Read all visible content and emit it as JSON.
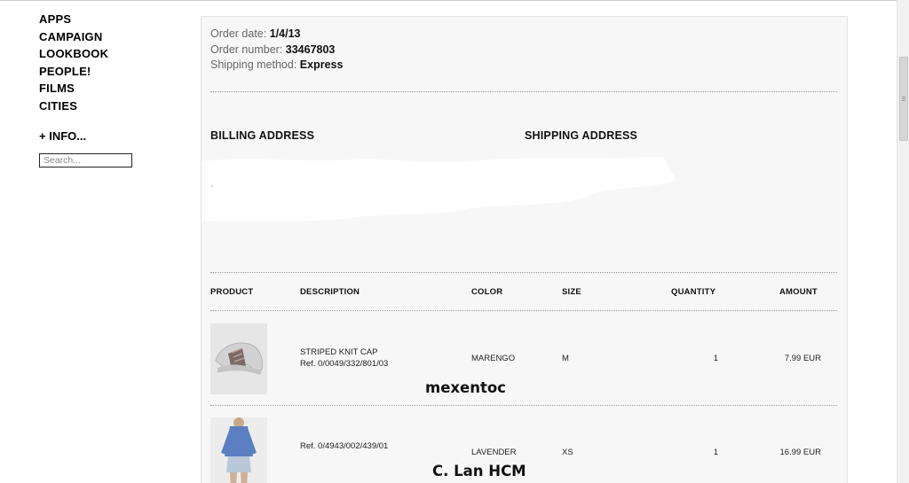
{
  "sidebar": {
    "nav": [
      "APPS",
      "CAMPAIGN",
      "LOOKBOOK",
      "PEOPLE!",
      "FILMS",
      "CITIES"
    ],
    "info_label": "+ INFO...",
    "search_placeholder": "Search..."
  },
  "order": {
    "date_label": "Order date:",
    "date_value": "1/4/13",
    "number_label": "Order number:",
    "number_value": "33467803",
    "shipping_label": "Shipping method:",
    "shipping_value": "Express"
  },
  "addresses": {
    "billing_title": "BILLING ADDRESS",
    "shipping_title": "SHIPPING ADDRESS"
  },
  "table": {
    "headers": {
      "product": "PRODUCT",
      "description": "DESCRIPTION",
      "color": "COLOR",
      "size": "SIZE",
      "quantity": "QUANTITY",
      "amount": "AMOUNT"
    },
    "rows": [
      {
        "name": "STRIPED KNIT CAP",
        "ref": "Ref. 0/0049/332/801/03",
        "color": "MARENGO",
        "size": "M",
        "quantity": "1",
        "amount": "7.99 EUR",
        "image": "knit-cap-photo"
      },
      {
        "name": "",
        "ref": "Ref. 0/4943/002/439/01",
        "color": "LAVENDER",
        "size": "XS",
        "quantity": "1",
        "amount": "16.99 EUR",
        "image": "blue-shirt-model-photo"
      }
    ]
  },
  "watermarks": [
    "mexentoc",
    "C. Lan HCM"
  ]
}
